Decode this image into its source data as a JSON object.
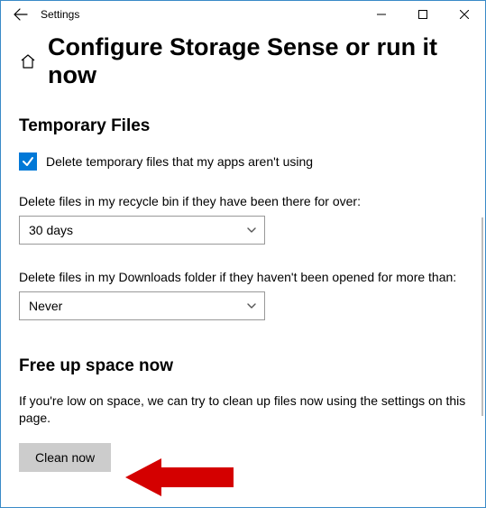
{
  "window": {
    "title": "Settings"
  },
  "page": {
    "heading": "Configure Storage Sense or run it now"
  },
  "temp": {
    "heading": "Temporary Files",
    "delete_temp_label": "Delete temporary files that my apps aren't using",
    "delete_temp_checked": true,
    "recycle_label": "Delete files in my recycle bin if they have been there for over:",
    "recycle_value": "30 days",
    "downloads_label": "Delete files in my Downloads folder if they haven't been opened for more than:",
    "downloads_value": "Never"
  },
  "freeup": {
    "heading": "Free up space now",
    "body": "If you're low on space, we can try to clean up files now using the settings on this page.",
    "button": "Clean now"
  }
}
